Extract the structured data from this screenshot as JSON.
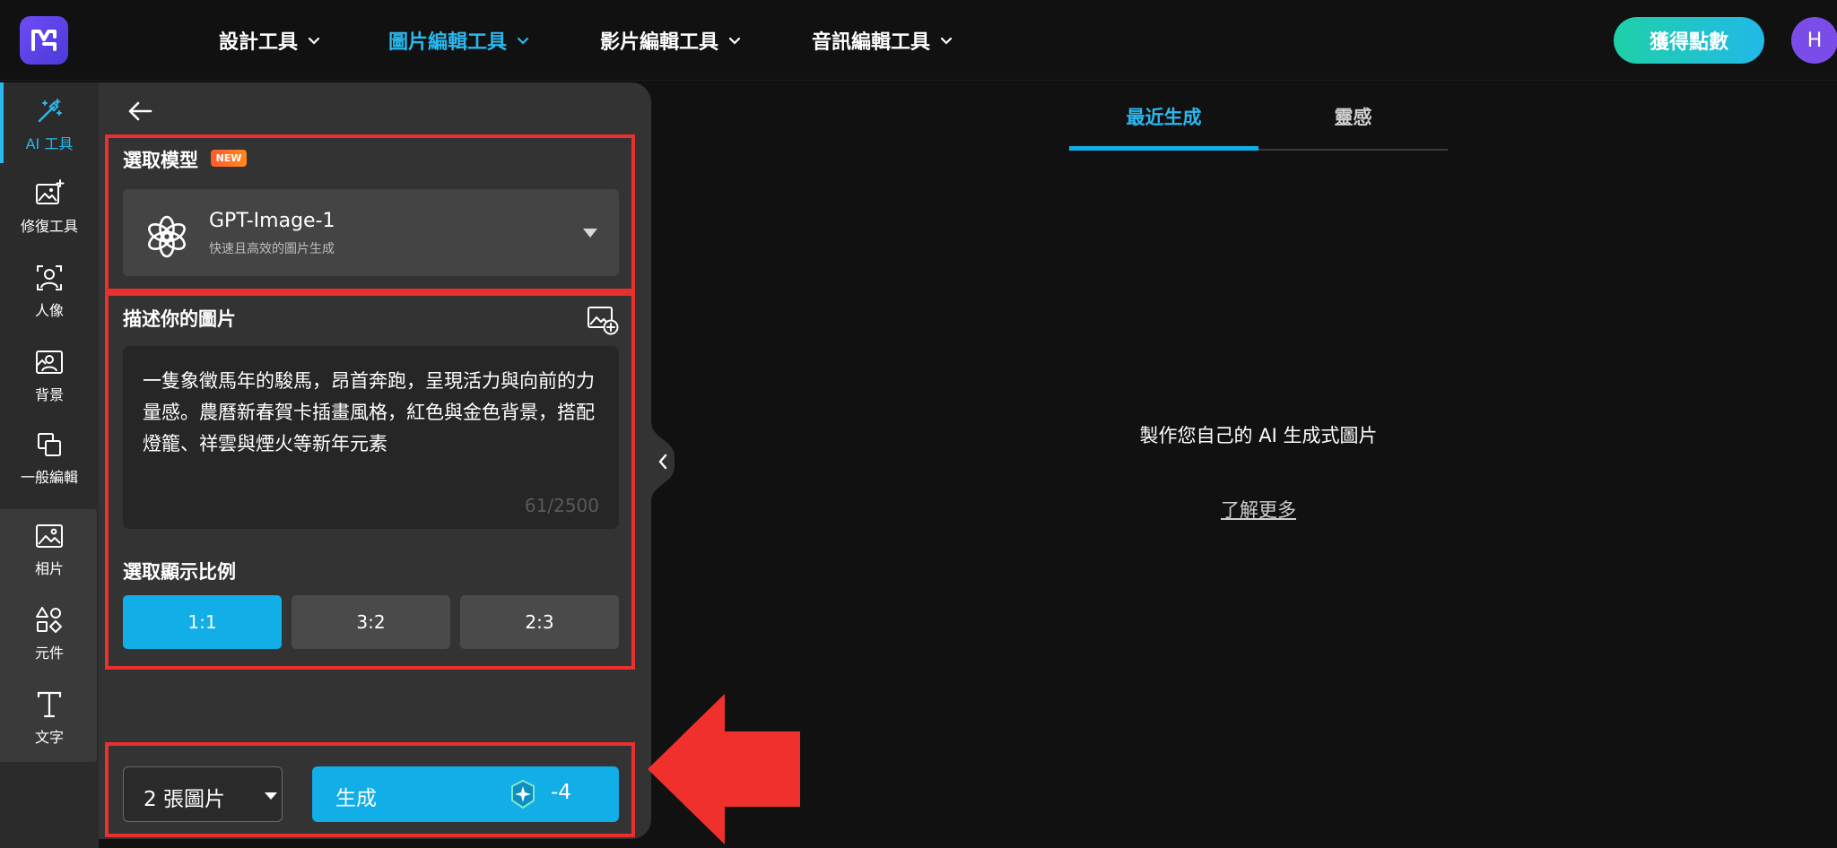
{
  "nav": {
    "items": [
      {
        "label": "設計工具"
      },
      {
        "label": "圖片編輯工具"
      },
      {
        "label": "影片編輯工具"
      },
      {
        "label": "音訊編輯工具"
      }
    ],
    "points_button": "獲得點數",
    "avatar_initial": "H"
  },
  "rail": {
    "items": [
      {
        "label": "AI 工具",
        "icon": "magic-wand-icon"
      },
      {
        "label": "修復工具",
        "icon": "image-sparkle-icon"
      },
      {
        "label": "人像",
        "icon": "portrait-icon"
      },
      {
        "label": "背景",
        "icon": "background-icon"
      },
      {
        "label": "一般編輯",
        "icon": "layers-icon"
      },
      {
        "label": "相片",
        "icon": "photo-icon"
      },
      {
        "label": "元件",
        "icon": "shapes-icon"
      },
      {
        "label": "文字",
        "icon": "text-icon"
      }
    ]
  },
  "panel": {
    "model_section_title": "選取模型",
    "new_badge": "NEW",
    "model": {
      "name": "GPT-Image-1",
      "description": "快速且高效的圖片生成"
    },
    "prompt_section_title": "描述你的圖片",
    "prompt_text": "一隻象徵馬年的駿馬，昂首奔跑，呈現活力與向前的力量感。農曆新春賀卡插畫風格，紅色與金色背景，搭配燈籠、祥雲與煙火等新年元素",
    "prompt_count": "61/2500",
    "ratio_section_title": "選取顯示比例",
    "ratios": [
      {
        "label": "1:1"
      },
      {
        "label": "3:2"
      },
      {
        "label": "2:3"
      }
    ],
    "image_count": "2 張圖片",
    "generate_label": "生成",
    "generate_cost": "-4"
  },
  "content": {
    "tabs": [
      {
        "label": "最近生成"
      },
      {
        "label": "靈感"
      }
    ],
    "empty_message": "製作您自己的 AI 生成式圖片",
    "learn_more": "了解更多"
  },
  "colors": {
    "accent": "#12aee8",
    "highlight_red": "#e8302f",
    "panel_bg": "#333333",
    "page_bg": "#111111"
  }
}
